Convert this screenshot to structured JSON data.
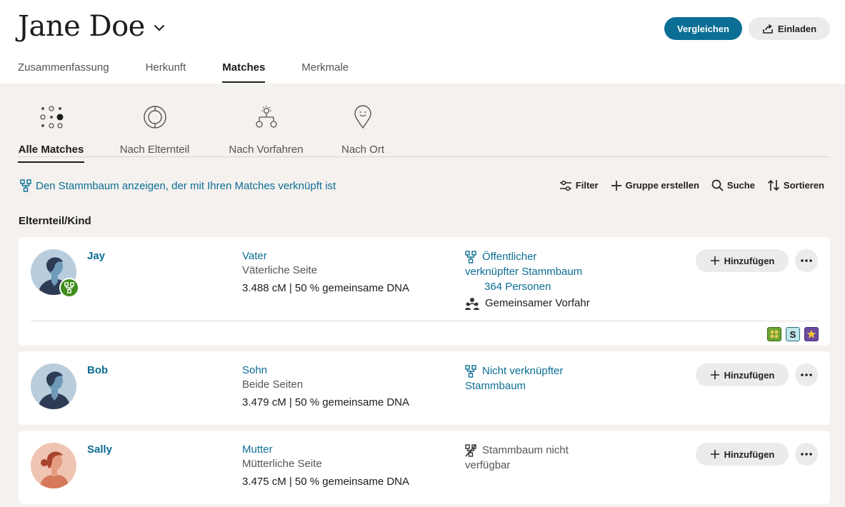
{
  "header": {
    "title": "Jane Doe",
    "compare_label": "Vergleichen",
    "invite_label": "Einladen"
  },
  "nav": {
    "tabs": [
      {
        "label": "Zusammenfassung"
      },
      {
        "label": "Herkunft"
      },
      {
        "label": "Matches",
        "active": true
      },
      {
        "label": "Merkmale"
      }
    ]
  },
  "subtabs": [
    {
      "label": "Alle Matches",
      "icon": "dots-grid-icon",
      "active": true
    },
    {
      "label": "Nach Elternteil",
      "icon": "circle-ring-icon"
    },
    {
      "label": "Nach Vorfahren",
      "icon": "ancestor-tree-icon"
    },
    {
      "label": "Nach Ort",
      "icon": "location-pin-icon"
    }
  ],
  "tree_link": "Den Stammbaum anzeigen, der mit Ihren Matches verknüpft ist",
  "toolbar": {
    "filter": "Filter",
    "create_group": "Gruppe erstellen",
    "search": "Suche",
    "sort": "Sortieren"
  },
  "group_label": "Elternteil/Kind",
  "add_label": "Hinzufügen",
  "matches": [
    {
      "name": "Jay",
      "relationship": "Vater",
      "side": "Väterliche Seite",
      "dna": "3.488 cM | 50 % gemeinsame DNA",
      "tree_line1": "Öffentlicher",
      "tree_line2": "verknüpfter Stammbaum",
      "tree_count": "364 Personen",
      "common_ancestor": "Gemeinsamer Vorfahr",
      "tags": [
        "group-tag-icon",
        "S",
        "star-icon"
      ]
    },
    {
      "name": "Bob",
      "relationship": "Sohn",
      "side": "Beide Seiten",
      "dna": "3.479 cM | 50 % gemeinsame DNA",
      "tree_line1": "Nicht verknüpfter",
      "tree_line2": "Stammbaum"
    },
    {
      "name": "Sally",
      "relationship": "Mutter",
      "side": "Mütterliche Seite",
      "dna": "3.475 cM | 50 % gemeinsame DNA",
      "tree_line1": "Stammbaum nicht",
      "tree_line2": "verfügbar"
    }
  ],
  "colors": {
    "accent": "#0b6e95",
    "background": "#f4f1ee",
    "badge_green": "#3f8c1b"
  }
}
